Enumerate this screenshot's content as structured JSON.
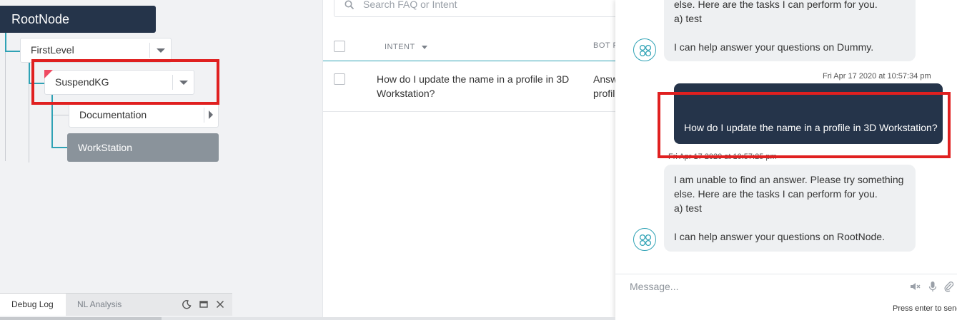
{
  "tree": {
    "root": "RootNode",
    "first_level": "FirstLevel",
    "suspend": "SuspendKG",
    "documentation": "Documentation",
    "workstation": "WorkStation"
  },
  "debug": {
    "tab_debug_log": "Debug Log",
    "tab_nl_analysis": "NL Analysis"
  },
  "faq": {
    "search_placeholder": "Search FAQ or Intent",
    "col_intent": "INTENT",
    "col_bot": "BOT R",
    "rows": [
      {
        "intent": "How do I update the name in a profile in 3D Workstation?",
        "bot": "Answ profil"
      }
    ]
  },
  "chat": {
    "msg1_lines": [
      "else. Here are the tasks I can perform for you.",
      "a) test",
      "",
      "I can help answer your questions on Dummy."
    ],
    "user_time": "Fri Apr 17 2020 at 10:57:34 pm",
    "user_msg": "How do I update the name in a profile in 3D Workstation?",
    "bot_time": "Fri Apr 17 2020 at 10:57:25 pm",
    "msg2_lines": [
      "I am unable to find an answer. Please try something",
      "else. Here are the tasks I can perform for you.",
      "a) test",
      "",
      "I can help answer your questions on RootNode."
    ],
    "composer_placeholder": "Message...",
    "press_enter": "Press enter to send"
  },
  "colors": {
    "navy": "#25344a",
    "teal": "#2fa2b5",
    "highlight_red": "#e02020",
    "selected_node": "#8a939b"
  }
}
